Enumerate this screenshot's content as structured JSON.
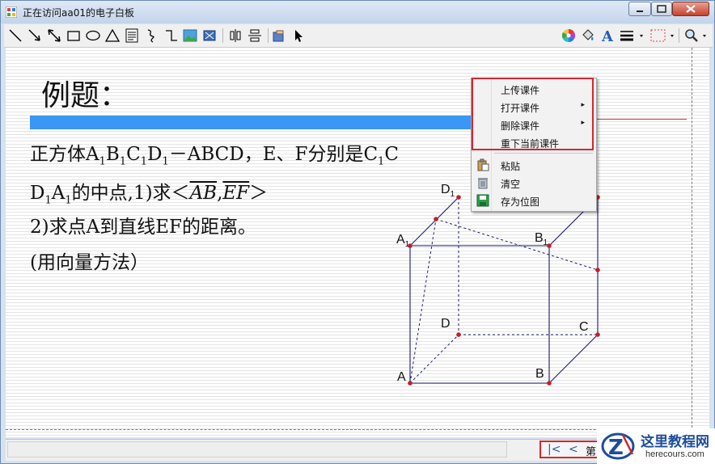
{
  "window": {
    "title": "正在访问aa01的电子白板"
  },
  "toolbar": {
    "left_tools": [
      "line-tool-icon",
      "arrow-tool-icon",
      "double-arrow-tool-icon",
      "rectangle-tool-icon",
      "ellipse-tool-icon",
      "triangle-tool-icon",
      "textbox-tool-icon",
      "freehand-tool-icon",
      "polyline-tool-icon",
      "image-tool-icon",
      "media-tool-icon",
      "align-tool-icon",
      "distribute-tool-icon",
      "hand-pointer-icon",
      "cursor-icon"
    ],
    "right_tools": [
      "color-wheel-icon",
      "fill-bucket-icon",
      "font-icon",
      "line-width-icon",
      "border-style-icon",
      "zoom-icon"
    ],
    "font_glyph": "A"
  },
  "board": {
    "heading": "例题：",
    "problem_line1": {
      "t1": "正方体A",
      "s1": "1",
      "t2": "B",
      "s2": "1",
      "t3": "C",
      "s3": "1",
      "t4": "D",
      "s4": "1",
      "t5": "－ABCD，E、F分别是C",
      "s5": "1",
      "t6": "C"
    },
    "problem_line2": {
      "t1": "D",
      "s1": "1",
      "t2": "A",
      "s2": "1",
      "t3": "的中点,1)求＜",
      "v1": "AB",
      "comma": ",",
      "v2": "EF",
      "t4": "＞"
    },
    "problem_line3": "2)求点A到直线EF的距离。",
    "problem_line4": "(用向量方法）",
    "cube_labels": {
      "D1": "D",
      "A1": "A",
      "B1": "B",
      "sub": "1",
      "D": "D",
      "C": "C",
      "A": "A",
      "B": "B"
    }
  },
  "context_menu": {
    "items": [
      {
        "label": "上传课件",
        "submenu": false,
        "icon": ""
      },
      {
        "label": "打开课件",
        "submenu": true,
        "icon": ""
      },
      {
        "label": "删除课件",
        "submenu": true,
        "icon": ""
      },
      {
        "label": "重下当前课件",
        "submenu": false,
        "icon": ""
      },
      {
        "label": "粘贴",
        "submenu": false,
        "icon": "paste-icon"
      },
      {
        "label": "清空",
        "submenu": false,
        "icon": "trash-icon"
      },
      {
        "label": "存为位图",
        "submenu": false,
        "icon": "save-icon"
      }
    ],
    "submenu_arrow": "▸"
  },
  "statusbar": {
    "first_page": "|<",
    "prev_page": "<",
    "page_label": "第"
  },
  "watermark": {
    "title": "这里教程网",
    "url": "herecours.com"
  },
  "colors": {
    "accent_blue": "#3a97f4",
    "highlight_red": "#d6262c",
    "cube_line": "#1a1a6e",
    "point_red": "#c0202a"
  }
}
